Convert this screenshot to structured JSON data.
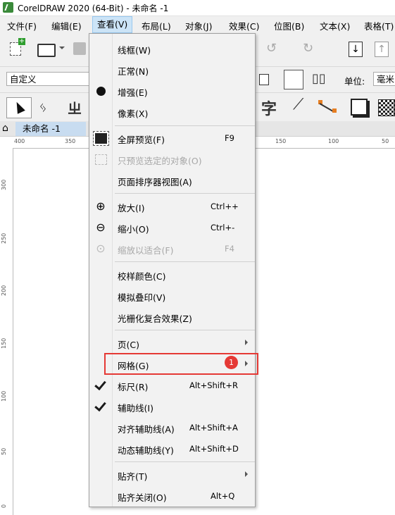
{
  "window": {
    "title": "CorelDRAW 2020 (64-Bit) - 未命名 -1"
  },
  "menubar": {
    "items": [
      {
        "label": "文件(F)"
      },
      {
        "label": "编辑(E)"
      },
      {
        "label": "查看(V)"
      },
      {
        "label": "布局(L)"
      },
      {
        "label": "对象(J)"
      },
      {
        "label": "效果(C)"
      },
      {
        "label": "位图(B)"
      },
      {
        "label": "文本(X)"
      },
      {
        "label": "表格(T)"
      }
    ]
  },
  "toolbar": {
    "preset_value": "自定义",
    "units_label": "单位:",
    "units_value": "毫米"
  },
  "document_tab": {
    "label": "未命名 -1"
  },
  "rulers": {
    "horizontal": [
      "400",
      "350",
      "150",
      "100",
      "50"
    ],
    "vertical": [
      "300",
      "250",
      "200",
      "150",
      "100",
      "50",
      "0"
    ]
  },
  "view_menu": {
    "items": [
      {
        "label": "线框(W)",
        "shortcut": "",
        "enabled": true,
        "icon": ""
      },
      {
        "label": "正常(N)",
        "shortcut": "",
        "enabled": true,
        "icon": ""
      },
      {
        "label": "增强(E)",
        "shortcut": "",
        "enabled": true,
        "icon": "selected-dot-icon"
      },
      {
        "label": "像素(X)",
        "shortcut": "",
        "enabled": true,
        "icon": ""
      },
      {
        "label": "全屏预览(F)",
        "shortcut": "F9",
        "enabled": true,
        "icon": "fullscreen-preview-icon"
      },
      {
        "label": "只预览选定的对象(O)",
        "shortcut": "",
        "enabled": false,
        "icon": "preview-selected-icon"
      },
      {
        "label": "页面排序器视图(A)",
        "shortcut": "",
        "enabled": true,
        "icon": ""
      },
      {
        "label": "放大(I)",
        "shortcut": "Ctrl++",
        "enabled": true,
        "icon": "zoom-in-icon"
      },
      {
        "label": "缩小(O)",
        "shortcut": "Ctrl+-",
        "enabled": true,
        "icon": "zoom-out-icon"
      },
      {
        "label": "缩放以适合(F)",
        "shortcut": "F4",
        "enabled": false,
        "icon": "zoom-fit-icon"
      },
      {
        "label": "校样颜色(C)",
        "shortcut": "",
        "enabled": true,
        "icon": ""
      },
      {
        "label": "模拟叠印(V)",
        "shortcut": "",
        "enabled": true,
        "icon": ""
      },
      {
        "label": "光栅化复合效果(Z)",
        "shortcut": "",
        "enabled": true,
        "icon": ""
      },
      {
        "label": "页(C)",
        "shortcut": "",
        "enabled": true,
        "icon": "",
        "submenu": true
      },
      {
        "label": "网格(G)",
        "shortcut": "",
        "enabled": true,
        "icon": "",
        "submenu": true
      },
      {
        "label": "标尺(R)",
        "shortcut": "Alt+Shift+R",
        "enabled": true,
        "icon": "checkmark-icon"
      },
      {
        "label": "辅助线(I)",
        "shortcut": "",
        "enabled": true,
        "icon": "checkmark-icon"
      },
      {
        "label": "对齐辅助线(A)",
        "shortcut": "Alt+Shift+A",
        "enabled": true,
        "icon": ""
      },
      {
        "label": "动态辅助线(Y)",
        "shortcut": "Alt+Shift+D",
        "enabled": true,
        "icon": ""
      },
      {
        "label": "贴齐(T)",
        "shortcut": "",
        "enabled": true,
        "icon": "",
        "submenu": true
      },
      {
        "label": "贴齐关闭(O)",
        "shortcut": "Alt+Q",
        "enabled": true,
        "icon": ""
      }
    ]
  },
  "annotation": {
    "badge": "1",
    "color": "#e53935"
  },
  "colors": {
    "menu_active": "#cce4f7",
    "tab_active": "#c8dcf0"
  }
}
